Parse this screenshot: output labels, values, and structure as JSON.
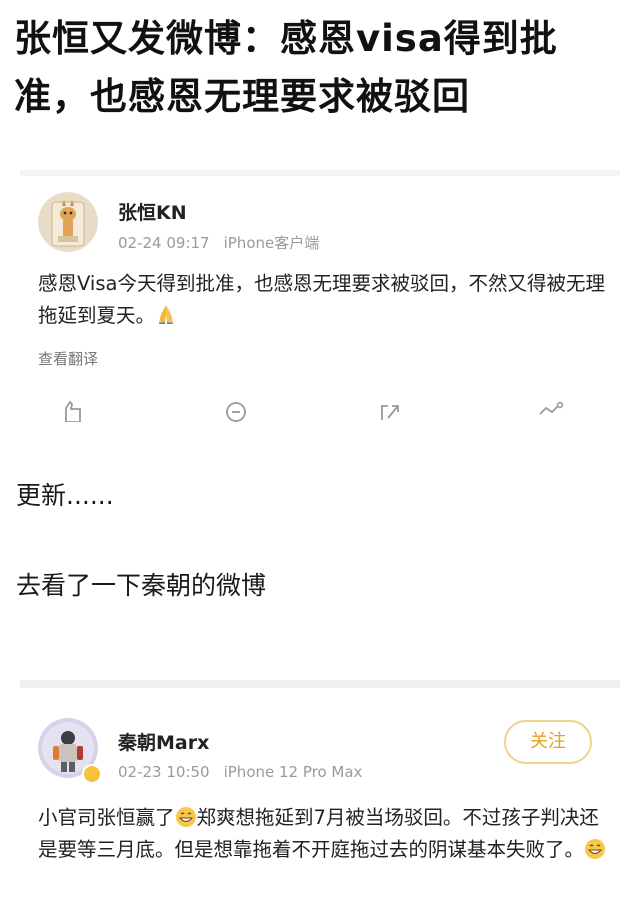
{
  "headline": "张恒又发微博：感恩visa得到批准，也感恩无理要求被驳回",
  "post1": {
    "author": "张恒KN",
    "date": "02-24 09:17",
    "source": "iPhone客户端",
    "text": "感恩Visa今天得到批准，也感恩无理要求被驳回，不然又得被无理拖延到夏天。",
    "translate": "查看翻译"
  },
  "update_text": "更新......",
  "visit_text": "去看了一下秦朝的微博",
  "post2": {
    "author": "秦朝Marx",
    "date": "02-23 10:50",
    "source": "iPhone 12 Pro Max",
    "follow": "关注",
    "text_part1": "小官司张恒赢了",
    "text_part2": "郑爽想拖延到7月被当场驳回。不过孩子判决还是要等三月底。但是想靠拖着不开庭拖过去的阴谋基本失败了。"
  },
  "colors": {
    "follow_text": "#e8a020",
    "follow_border": "#f0d38a",
    "meta": "#9a9a9a"
  },
  "icons": [
    "like-icon",
    "comment-icon",
    "repost-icon",
    "more-icon",
    "pray-emoji",
    "grin-emoji"
  ]
}
